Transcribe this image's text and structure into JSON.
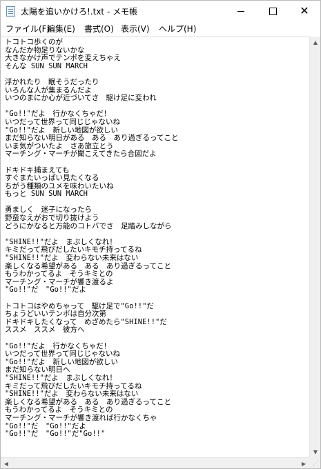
{
  "window": {
    "title": "太陽を追いかけろ!.txt - メモ帳",
    "close_glyph": "✕"
  },
  "menu": [
    {
      "label": "ファイル(F)"
    },
    {
      "label": "編集(E)"
    },
    {
      "label": "書式(O)"
    },
    {
      "label": "表示(V)"
    },
    {
      "label": "ヘルプ(H)"
    }
  ],
  "icons": {
    "app": "notepad-icon",
    "scroll_up": "▲",
    "scroll_down": "▼",
    "scroll_left": "◀",
    "scroll_right": "▶",
    "grip": "⋰"
  },
  "document": {
    "text": "トコトコ歩くのが\nなんだか物足りないかな\n大きなかけ声でテンポを変えちゃえ\nそんな SUN SUN MARCH\n\n浮かれたり　眠そうだったり\nいろんな人が集まるんだよ\nいつのまにか心が近づいてさ　駆け足に変われ\n\n\"Go!!\"だよ　行かなくちゃだ！\nいつだって世界って同じじゃないね\n\"Go!!\"だよ　新しい地図が欲しい\nまだ知らない明日がある　ある　あり過ぎるってこと\nいま気がついたよ　さあ旅立とう\nマーチング・マーチが聞こえてきたら合図だよ\n\nドキドキ捕まえても\nすぐまたいっぱい見たくなる\nちがう種類のユメを味わいたいね\nもっと SUN SUN MARCH\n\n勇ましく　迷子になったら\n野蛮なえがおで切り抜けよう\nどうにかなると万能のコトバでさ　足踏みしながら\n\n\"SHINE!!\"だよ　まぶしくなれ！\nキミだって飛びだしたいキモチ持ってるね\n\"SHINE!!\"だよ　変わらない未来はない\n楽しくなる希望がある　ある　あり過ぎるってこと\nもうわかってるよ　そうキミとの\nマーチング・マーチが響き渡るよ\n\"Go!!\"だ　\"Go!!\"だよ\n\nトコトコはやめちゃって　駆け足で\"Go!!\"だ\nちょうどいいテンポは自分次第\nドキドキしたくなって　めざめたら\"SHINE!!\"だ\nススメ　ススメ　彼方へ\n\n\"Go!!\"だよ　行かなくちゃだ！\nいつだって世界って同じじゃないね\n\"Go!!\"だよ　新しい地図が欲しい\nまだ知らない明日へ\n\"SHINE!!\"だよ　まぶしくなれ！\nキミだって飛びだしたいキモチ持ってるね\n\"SHINE!!\"だよ　変わらない未来はない\n楽しくなる希望がある　ある　あり過ぎるってこと\nもうわかってるよ　そうキミとの\nマーチング・マーチが響き渡れば行かなくちゃ\n\"Go!!\"だ　\"Go!!\"だよ\n\"Go!!\"だ　\"Go!!\"だ\"Go!!\""
  }
}
